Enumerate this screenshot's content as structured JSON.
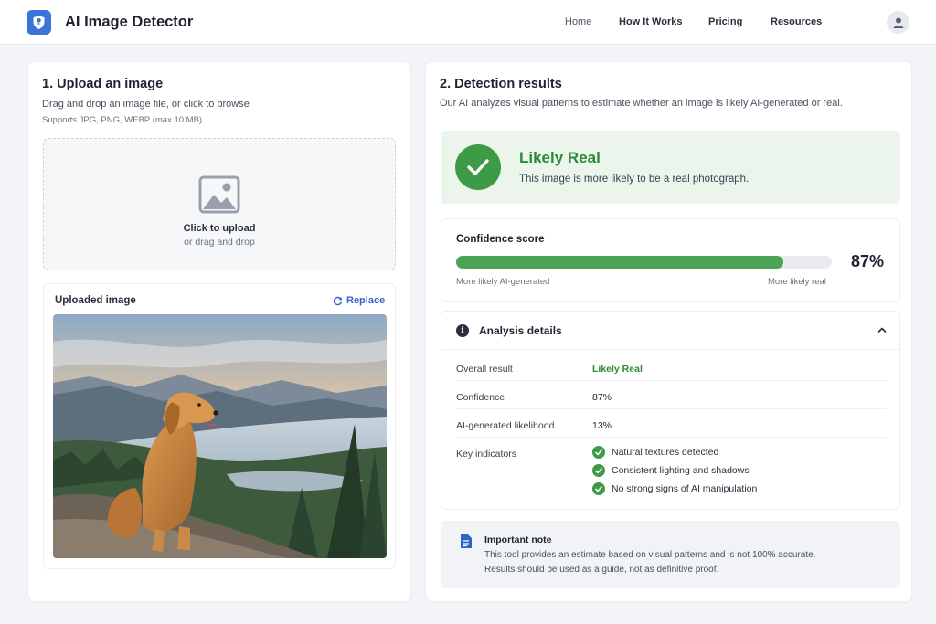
{
  "header": {
    "app_title": "AI Image Detector",
    "logo_icon": "shield-icon",
    "nav": [
      "Home",
      "How It Works",
      "Pricing",
      "Resources"
    ],
    "avatar_icon": "user-icon"
  },
  "upload": {
    "title": "1. Upload an image",
    "subtitle": "Drag and drop an image file, or click to browse",
    "supports": "Supports JPG, PNG, WEBP (max 10 MB)",
    "dropzone_icon": "image-icon",
    "dropzone_title": "Click to upload",
    "dropzone_sub": "or drag and drop",
    "uploaded_title": "Uploaded image",
    "replace_label": "Replace",
    "replace_icon": "refresh-icon"
  },
  "results": {
    "title": "2. Detection results",
    "subtitle": "Our AI analyzes visual patterns to estimate whether an image is likely AI-generated or real.",
    "verdict_title": "Likely Real",
    "verdict_sub": "This image is more likely to be a real photograph.",
    "verdict_color": "#2a8a38",
    "confidence_label": "Confidence score",
    "confidence_value": 0.87,
    "confidence_text": "87%",
    "scale_left": "More likely AI-generated",
    "scale_right": "More likely real",
    "analysis_title": "Analysis details",
    "rows": [
      {
        "key": "Overall result",
        "value": "Likely Real"
      },
      {
        "key": "Confidence",
        "value": "87%"
      },
      {
        "key": "AI-generated likelihood",
        "value": "13%"
      }
    ],
    "indicators_label": "Key indicators",
    "indicators": [
      "Natural textures detected",
      "Consistent lighting and shadows",
      "No strong signs of AI manipulation"
    ],
    "note_title": "Important note",
    "note_lines": [
      "This tool provides an estimate based on visual patterns and is not 100% accurate.",
      "Results should be used as a guide, not as definitive proof."
    ]
  }
}
